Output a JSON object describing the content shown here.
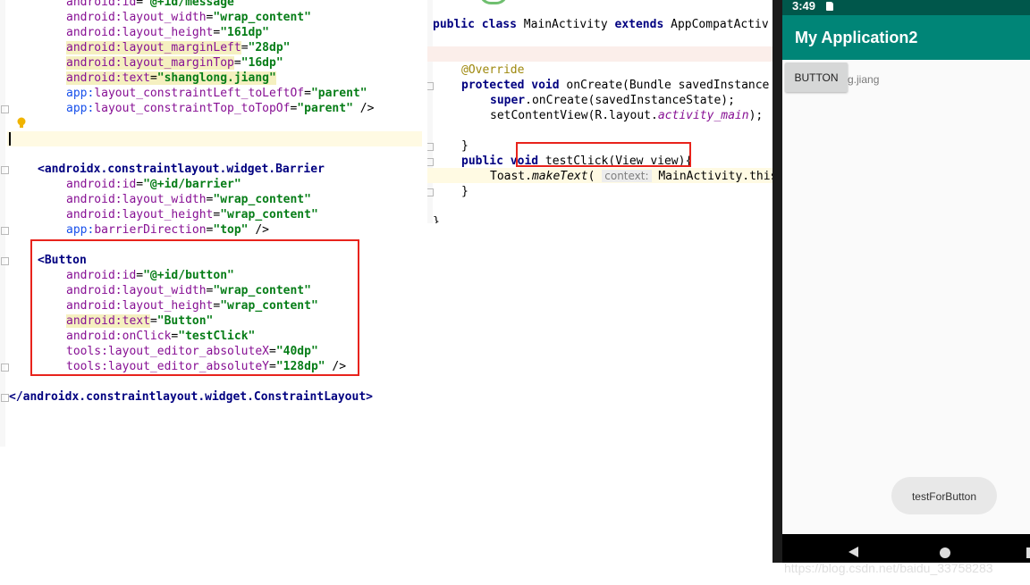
{
  "xml_editor": {
    "lines": [
      {
        "prefix": "android:",
        "attr": "id",
        "eq": "=",
        "value": "\"@+id/message\""
      },
      {
        "prefix": "android:",
        "attr": "layout_width",
        "eq": "=",
        "value": "\"wrap_content\""
      },
      {
        "prefix": "android:",
        "attr": "layout_height",
        "eq": "=",
        "value": "\"161dp\""
      },
      {
        "prefix": "android:",
        "attr": "layout_marginLeft",
        "eq": "=",
        "value": "\"28dp\""
      },
      {
        "prefix": "android:",
        "attr": "layout_marginTop",
        "eq": "=",
        "value": "\"16dp\""
      },
      {
        "prefix": "android:",
        "attr": "text",
        "eq": "=",
        "value": "\"shanglong.jiang\""
      },
      {
        "prefix": "app:",
        "attr": "layout_constraintLeft_toLeftOf",
        "eq": "=",
        "value": "\"parent\""
      },
      {
        "prefix": "app:",
        "attr": "layout_constraintTop_toTopOf",
        "eq": "=",
        "value": "\"parent\"",
        "suffix": " />"
      }
    ],
    "barrier_tag": "<androidx.constraintlayout.widget.Barrier",
    "barrier_lines": [
      {
        "prefix": "android:",
        "attr": "id",
        "eq": "=",
        "value": "\"@+id/barrier\""
      },
      {
        "prefix": "android:",
        "attr": "layout_width",
        "eq": "=",
        "value": "\"wrap_content\""
      },
      {
        "prefix": "android:",
        "attr": "layout_height",
        "eq": "=",
        "value": "\"wrap_content\""
      },
      {
        "prefix": "app:",
        "attr": "barrierDirection",
        "eq": "=",
        "value": "\"top\"",
        "suffix": " />"
      }
    ],
    "button_tag": "<Button",
    "button_lines": [
      {
        "prefix": "android:",
        "attr": "id",
        "eq": "=",
        "value": "\"@+id/button\""
      },
      {
        "prefix": "android:",
        "attr": "layout_width",
        "eq": "=",
        "value": "\"wrap_content\""
      },
      {
        "prefix": "android:",
        "attr": "layout_height",
        "eq": "=",
        "value": "\"wrap_content\""
      },
      {
        "prefix": "android:",
        "attr": "text",
        "eq": "=",
        "value": "\"Button\""
      },
      {
        "prefix": "android:",
        "attr": "onClick",
        "eq": "=",
        "value": "\"testClick\""
      },
      {
        "prefix": "tools:",
        "attr": "layout_editor_absoluteX",
        "eq": "=",
        "value": "\"40dp\""
      },
      {
        "prefix": "tools:",
        "attr": "layout_editor_absoluteY",
        "eq": "=",
        "value": "\"128dp\"",
        "suffix": " />"
      }
    ],
    "closing_tag": "</androidx.constraintlayout.widget.ConstraintLayout>"
  },
  "java_editor": {
    "class_line": {
      "kw1": "public class ",
      "name": "MainActivity ",
      "kw2": "extends ",
      "parent": "AppCompatActiv"
    },
    "override": "@Override",
    "oncreate": {
      "kw": "protected void ",
      "rest": "onCreate(Bundle savedInstance"
    },
    "super_call": {
      "kw": "super",
      "rest": ".onCreate(savedInstanceState);"
    },
    "setcontent": {
      "pre": "setContentView(R.layout.",
      "it": "activity_main",
      "post": ");"
    },
    "brace_close": "}",
    "testclick": {
      "kw": "public void ",
      "rest": "testClick(View view){"
    },
    "toast": {
      "pre": "Toast.",
      "it": "makeText",
      "paren": "(",
      "hint": "context:",
      "post": " MainActivity.this"
    },
    "brace_close2": "}",
    "brace_close3": "}"
  },
  "emulator": {
    "status_time": "3:49",
    "app_title": "My Application2",
    "button_label": "BUTTON",
    "message_text": "g.jiang",
    "toast_text": "testForButton"
  },
  "watermark": "https://blog.csdn.net/baidu_33758283",
  "colors": {
    "app_bar": "#008577",
    "status_bar": "#00574b",
    "highlight_box": "#e8231c"
  }
}
